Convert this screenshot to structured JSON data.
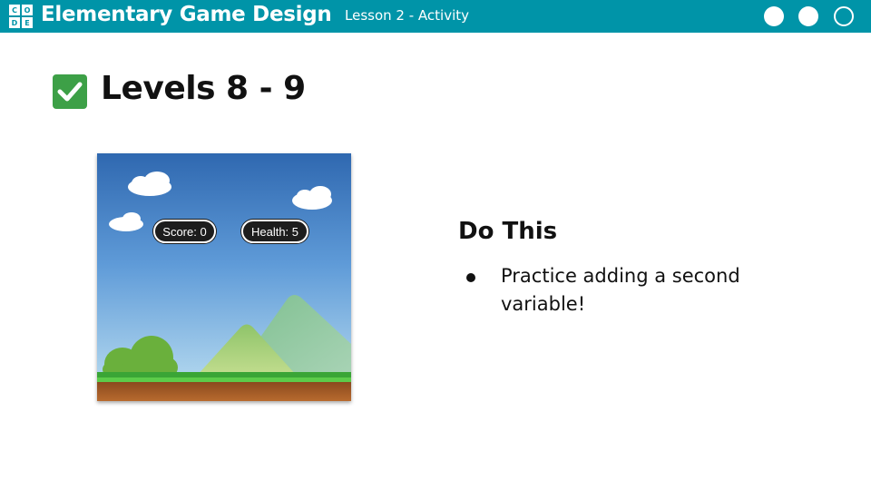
{
  "header": {
    "logo_letters": [
      "C",
      "O",
      "D",
      "E"
    ],
    "title": "Elementary Game Design",
    "lesson": "Lesson 2 - Activity",
    "progress_dots": [
      "filled",
      "filled",
      "outline"
    ]
  },
  "slide": {
    "title": "Levels 8 - 9",
    "check_icon": "check-box-icon"
  },
  "game_preview": {
    "score_label": "Score: 0",
    "health_label": "Health: 5"
  },
  "instructions": {
    "heading": "Do This",
    "items": [
      "Practice adding a second variable!"
    ]
  },
  "colors": {
    "header_bg": "#0094a8",
    "check_green": "#3da047",
    "text": "#111111"
  }
}
